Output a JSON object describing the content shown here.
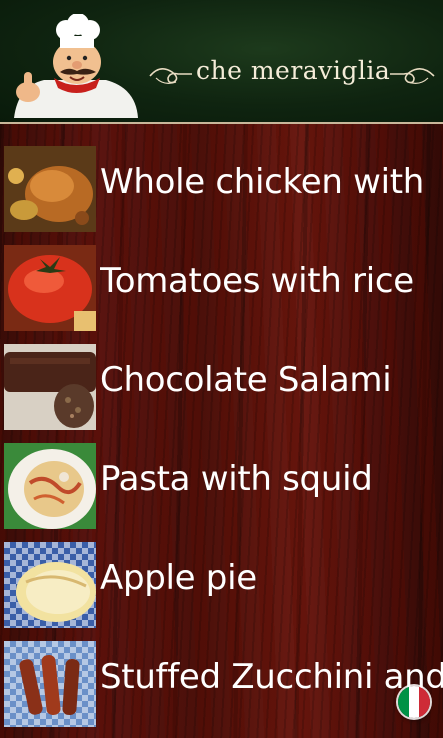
{
  "header": {
    "logo_text": "che meraviglia"
  },
  "recipes": [
    {
      "title": "Whole chicken with",
      "image": "roast-chicken"
    },
    {
      "title": "Tomatoes with rice",
      "image": "stuffed-tomatoes"
    },
    {
      "title": "Chocolate Salami",
      "image": "chocolate-salami"
    },
    {
      "title": "Pasta with squid",
      "image": "pasta-squid"
    },
    {
      "title": "Apple pie",
      "image": "apple-pie"
    },
    {
      "title": "Stuffed Zucchini and",
      "image": "stuffed-zucchini"
    }
  ],
  "language_flag": {
    "icon": "italy-flag-icon",
    "colors": [
      "#009246",
      "#ffffff",
      "#ce2b37"
    ]
  },
  "colors": {
    "header_bg": "#0f2410",
    "wood_bg": "#5a1410",
    "text": "#ffffff"
  }
}
